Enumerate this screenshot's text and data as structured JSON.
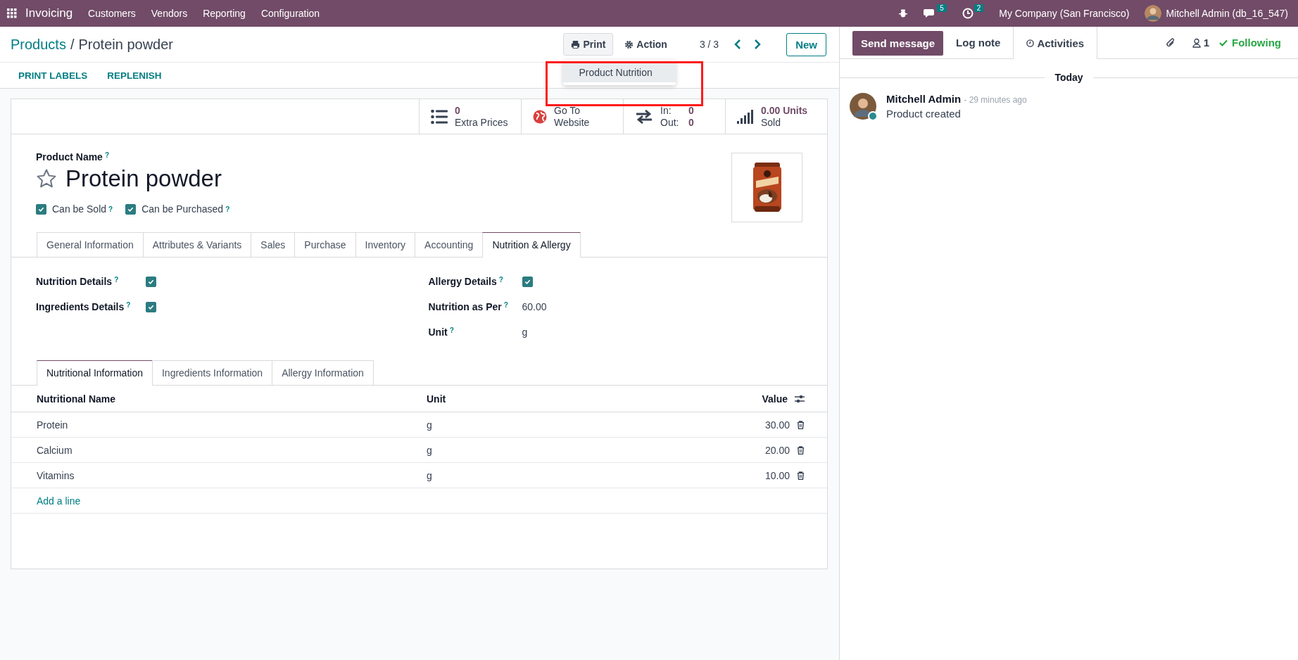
{
  "navbar": {
    "app": "Invoicing",
    "menus": [
      "Customers",
      "Vendors",
      "Reporting",
      "Configuration"
    ],
    "messages_count": "5",
    "activities_count": "2",
    "company": "My Company (San Francisco)",
    "user": "Mitchell Admin (db_16_547)"
  },
  "breadcrumb": {
    "parent": "Products",
    "separator": "/",
    "current": "Protein powder"
  },
  "toolbar": {
    "print": "Print",
    "action": "Action",
    "pager": "3 / 3",
    "new": "New"
  },
  "print_menu": {
    "items": [
      "Product Nutrition"
    ]
  },
  "actions": [
    "PRINT LABELS",
    "REPLENISH"
  ],
  "stat_buttons": [
    {
      "kind": "count",
      "lines": [
        "0",
        "Extra Prices"
      ]
    },
    {
      "kind": "website",
      "lines": [
        "Go To",
        "Website"
      ]
    },
    {
      "kind": "moves",
      "rows": [
        {
          "label": "In:",
          "value": "0"
        },
        {
          "label": "Out:",
          "value": "0"
        }
      ]
    },
    {
      "kind": "sold",
      "lines": [
        "0.00 Units",
        "Sold"
      ]
    }
  ],
  "product": {
    "name_label": "Product Name",
    "help": "?",
    "name": "Protein powder",
    "options": [
      {
        "label": "Can be Sold",
        "help": "?",
        "checked": true
      },
      {
        "label": "Can be Purchased",
        "help": "?",
        "checked": true
      }
    ]
  },
  "tabs": [
    {
      "label": "General Information",
      "selected": false
    },
    {
      "label": "Attributes & Variants",
      "selected": false
    },
    {
      "label": "Sales",
      "selected": false
    },
    {
      "label": "Purchase",
      "selected": false
    },
    {
      "label": "Inventory",
      "selected": false
    },
    {
      "label": "Accounting",
      "selected": false
    },
    {
      "label": "Nutrition & Allergy",
      "selected": true
    }
  ],
  "fields_left": [
    {
      "kind": "checkbox",
      "label": "Nutrition Details",
      "help": "?",
      "checked": true
    },
    {
      "kind": "checkbox",
      "label": "Ingredients Details",
      "help": "?",
      "checked": true
    }
  ],
  "fields_right": [
    {
      "kind": "checkbox",
      "label": "Allergy Details",
      "help": "?",
      "checked": true
    },
    {
      "kind": "text",
      "label": "Nutrition as Per",
      "help": "?",
      "value": "60.00"
    },
    {
      "kind": "text",
      "label": "Unit",
      "help": "?",
      "value": "g"
    }
  ],
  "subtabs": [
    {
      "label": "Nutritional Information",
      "selected": true
    },
    {
      "label": "Ingredients Information",
      "selected": false
    },
    {
      "label": "Allergy Information",
      "selected": false
    }
  ],
  "table": {
    "columns": [
      "Nutritional Name",
      "Unit",
      "Value"
    ],
    "rows": [
      {
        "name": "Protein",
        "unit": "g",
        "value": "30.00"
      },
      {
        "name": "Calcium",
        "unit": "g",
        "value": "20.00"
      },
      {
        "name": "Vitamins",
        "unit": "g",
        "value": "10.00"
      }
    ],
    "add_line": "Add a line"
  },
  "chatter": {
    "buttons": [
      {
        "kind": "primary",
        "label": "Send message"
      },
      {
        "kind": "plain",
        "label": "Log note"
      },
      {
        "kind": "tab",
        "label": "Activities"
      }
    ],
    "followers": "1",
    "following": "Following",
    "date": "Today",
    "messages": [
      {
        "author": "Mitchell Admin",
        "time": "- 29 minutes ago",
        "body": "Product created",
        "online": true
      }
    ]
  }
}
